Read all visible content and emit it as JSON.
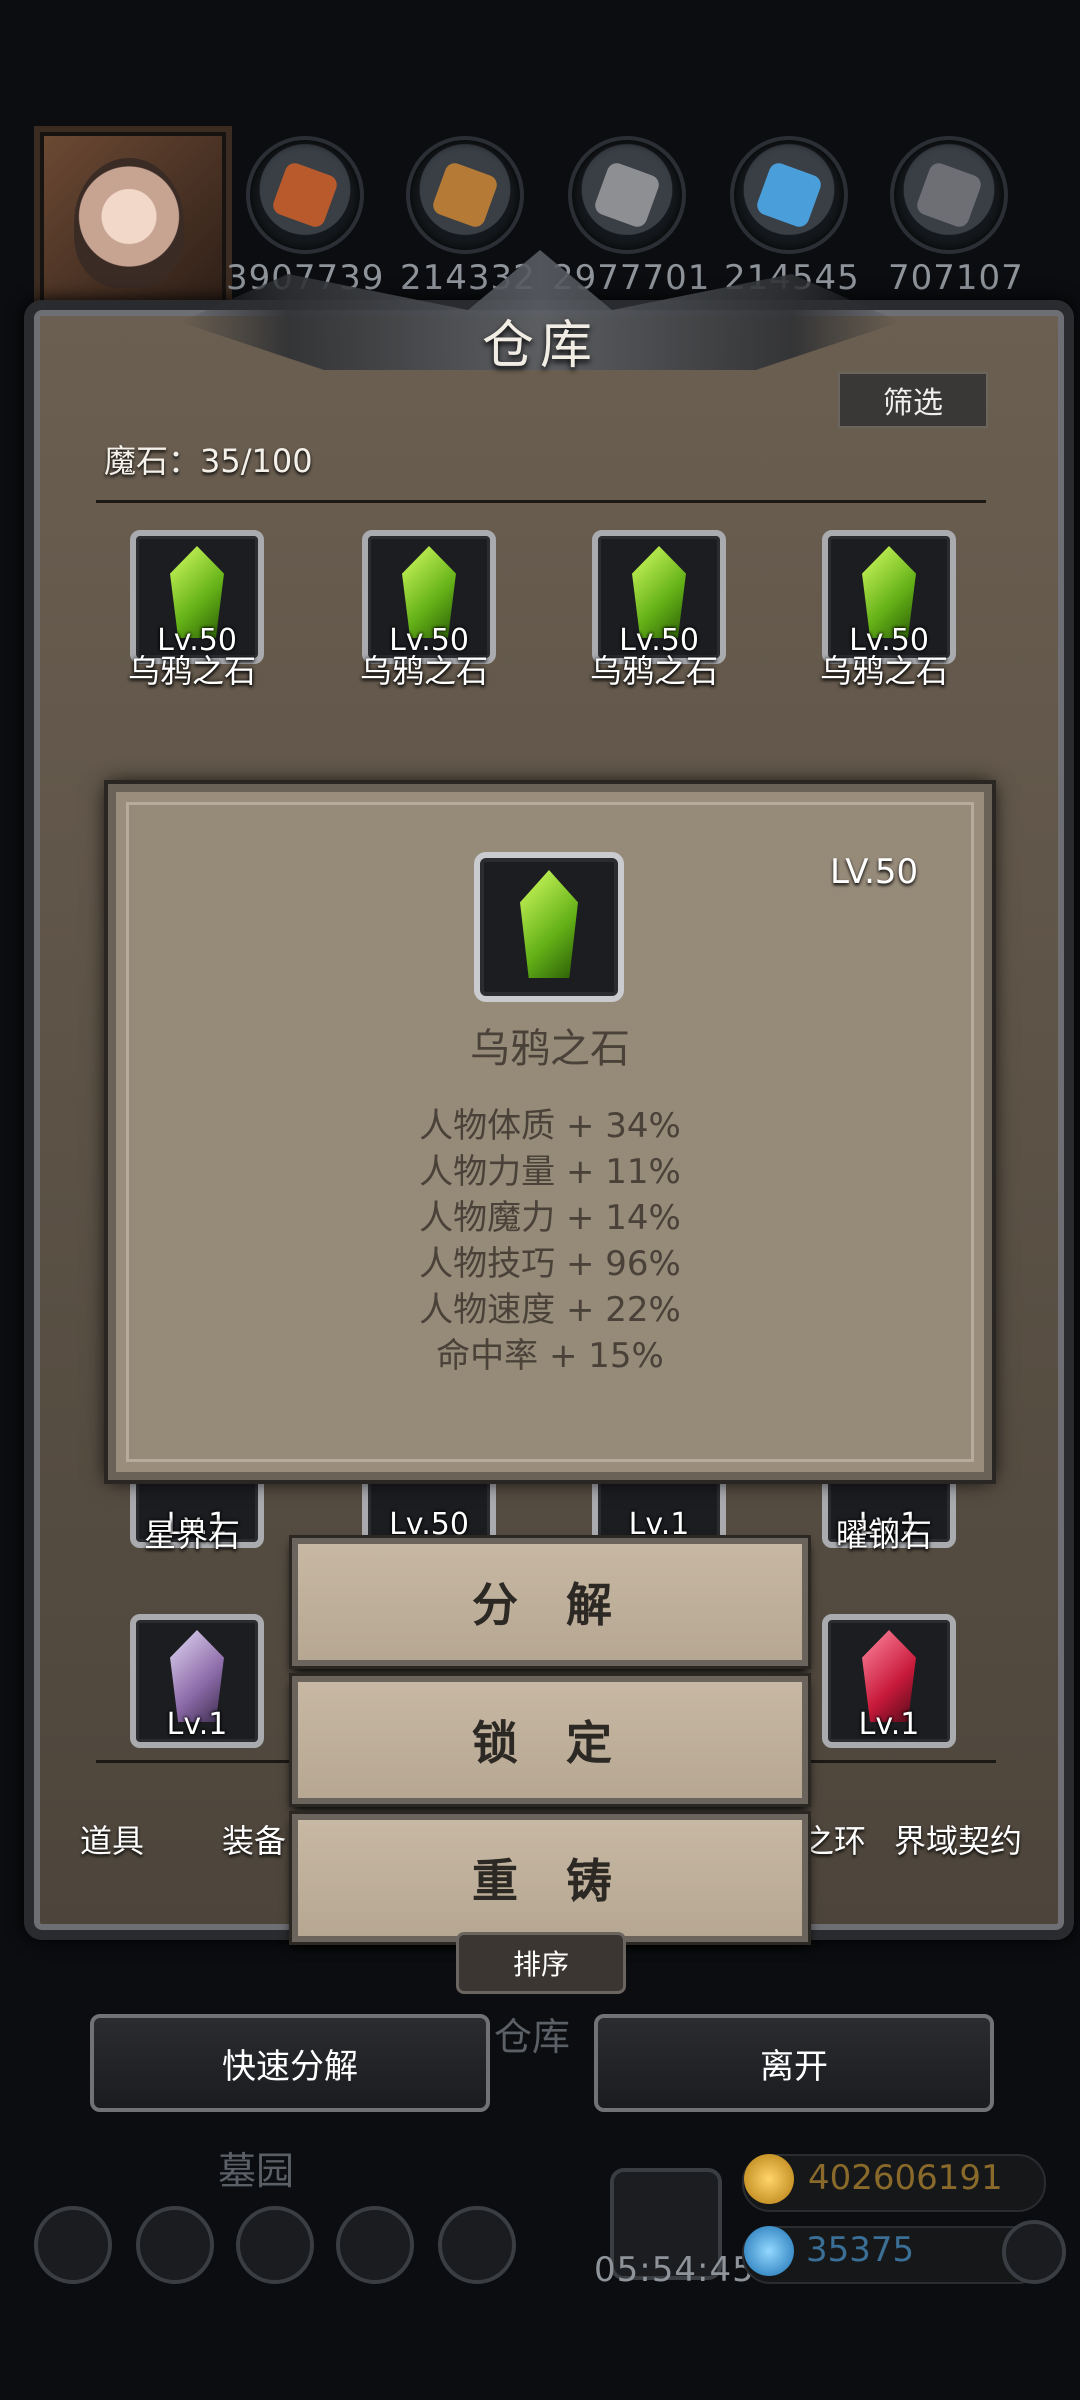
{
  "resources": [
    {
      "name": "copper-ore",
      "value": "3907739",
      "color": "#b85a2b"
    },
    {
      "name": "wood",
      "value": "214332",
      "color": "#b57a35"
    },
    {
      "name": "iron-ingot",
      "value": "2977701",
      "color": "#8e8f93"
    },
    {
      "name": "crystal",
      "value": "214545",
      "color": "#4a9fdb"
    },
    {
      "name": "steel",
      "value": "707107",
      "color": "#6d6f75"
    }
  ],
  "panel": {
    "title": "仓库",
    "filter_label": "筛选",
    "magic_stone_label": "魔石：35/100"
  },
  "grid": {
    "row1": [
      {
        "level": "Lv.50",
        "name": "乌鸦之石"
      },
      {
        "level": "Lv.50",
        "name": "乌鸦之石"
      },
      {
        "level": "Lv.50",
        "name": "乌鸦之石"
      },
      {
        "level": "Lv.50",
        "name": "乌鸦之石"
      }
    ],
    "row3": [
      {
        "level": "Lv.1",
        "name": "星界石"
      },
      {
        "level": "Lv.50",
        "name": ""
      },
      {
        "level": "Lv.1",
        "name": ""
      },
      {
        "level": "Lv.1",
        "name": "曜钢石"
      }
    ],
    "row4": [
      {
        "level": "Lv.1",
        "name": ""
      },
      {
        "level": "Lv.1",
        "name": ""
      }
    ]
  },
  "tabs": [
    "道具",
    "装备",
    "之环",
    "界域契约"
  ],
  "modal": {
    "level": "LV.50",
    "item_name": "乌鸦之石",
    "stats": [
      "人物体质 + 34%",
      "人物力量 + 11%",
      "人物魔力 + 14%",
      "人物技巧 + 96%",
      "人物速度 + 22%",
      "命中率 + 15%"
    ]
  },
  "actions": {
    "decompose": "分 解",
    "lock": "锁 定",
    "reforge": "重 铸"
  },
  "sort_label": "排序",
  "bottom": {
    "quick_decompose": "快速分解",
    "leave": "离开",
    "behind_label": "仓库",
    "graveyard": "墓园",
    "timer": "05:54:45"
  },
  "currency": {
    "gold": "402606191",
    "gem": "35375"
  }
}
